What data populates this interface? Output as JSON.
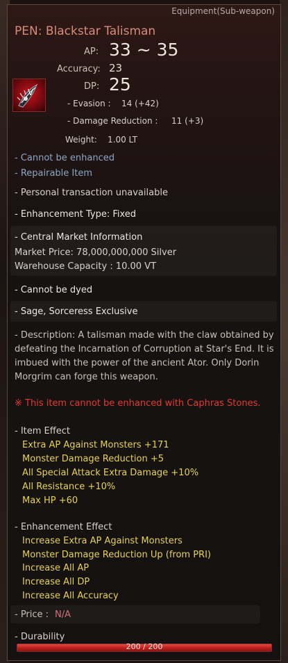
{
  "item": {
    "category": "Equipment(Sub-weapon)",
    "name": "PEN: Blackstar Talisman",
    "grade_badge": "V"
  },
  "stats": {
    "ap_label": "AP:",
    "ap_value": "33 ~ 35",
    "accuracy_label": "Accuracy:",
    "accuracy_value": "23",
    "dp_label": "DP:",
    "dp_value": "25",
    "evasion_label": "- Evasion :",
    "evasion_value": "14 (+42)",
    "damage_reduction_label": "- Damage Reduction :",
    "damage_reduction_value": "11 (+3)",
    "weight_label": "Weight:",
    "weight_value": "1.00 LT"
  },
  "flags": {
    "cannot_enhance": "- Cannot be enhanced",
    "repairable": "- Repairable Item",
    "personal_transaction": "- Personal transaction unavailable",
    "enhancement_type": "- Enhancement Type: Fixed"
  },
  "market": {
    "heading": "- Central Market Information",
    "market_price": "Market Price: 78,000,000,000 Silver",
    "warehouse": "Warehouse Capacity : 10.00 VT"
  },
  "restrictions": {
    "dye": "- Cannot be dyed",
    "classes": "- Sage, Sorceress Exclusive"
  },
  "description": {
    "line1": "- Description: A talisman made with the claw obtained by",
    "line2": "defeating the Incarnation of Corruption at Star's End. It is",
    "line3": "imbued with the power of the ancient Ator. Only Dorin",
    "line4": "Morgrim can forge this weapon."
  },
  "warning": "※ This item cannot be enhanced with Caphras Stones.",
  "item_effect": {
    "heading": "- Item Effect",
    "lines": [
      "Extra AP Against Monsters +171",
      "Monster Damage Reduction +5",
      "All Special Attack Extra Damage +10%",
      "All Resistance +10%",
      "Max HP +60"
    ]
  },
  "enhancement_effect": {
    "heading": "- Enhancement Effect",
    "lines": [
      "Increase Extra AP Against Monsters",
      "Monster Damage Reduction Up (from PRI)",
      "Increase All AP",
      "Increase All DP",
      "Increase All Accuracy"
    ]
  },
  "price": {
    "label": "- Price :",
    "value": "N/A"
  },
  "durability": {
    "label": "- Durability",
    "text": "200 / 200",
    "current": 200,
    "max": 200
  },
  "colors": {
    "title": "#d98c7a",
    "blue_text": "#8ea6c4",
    "yellow_text": "#e7d34d",
    "warning_red": "#e23b30",
    "bar_red": "#d3312a"
  },
  "icons": {
    "item_icon": "talisman-claw-icon"
  }
}
